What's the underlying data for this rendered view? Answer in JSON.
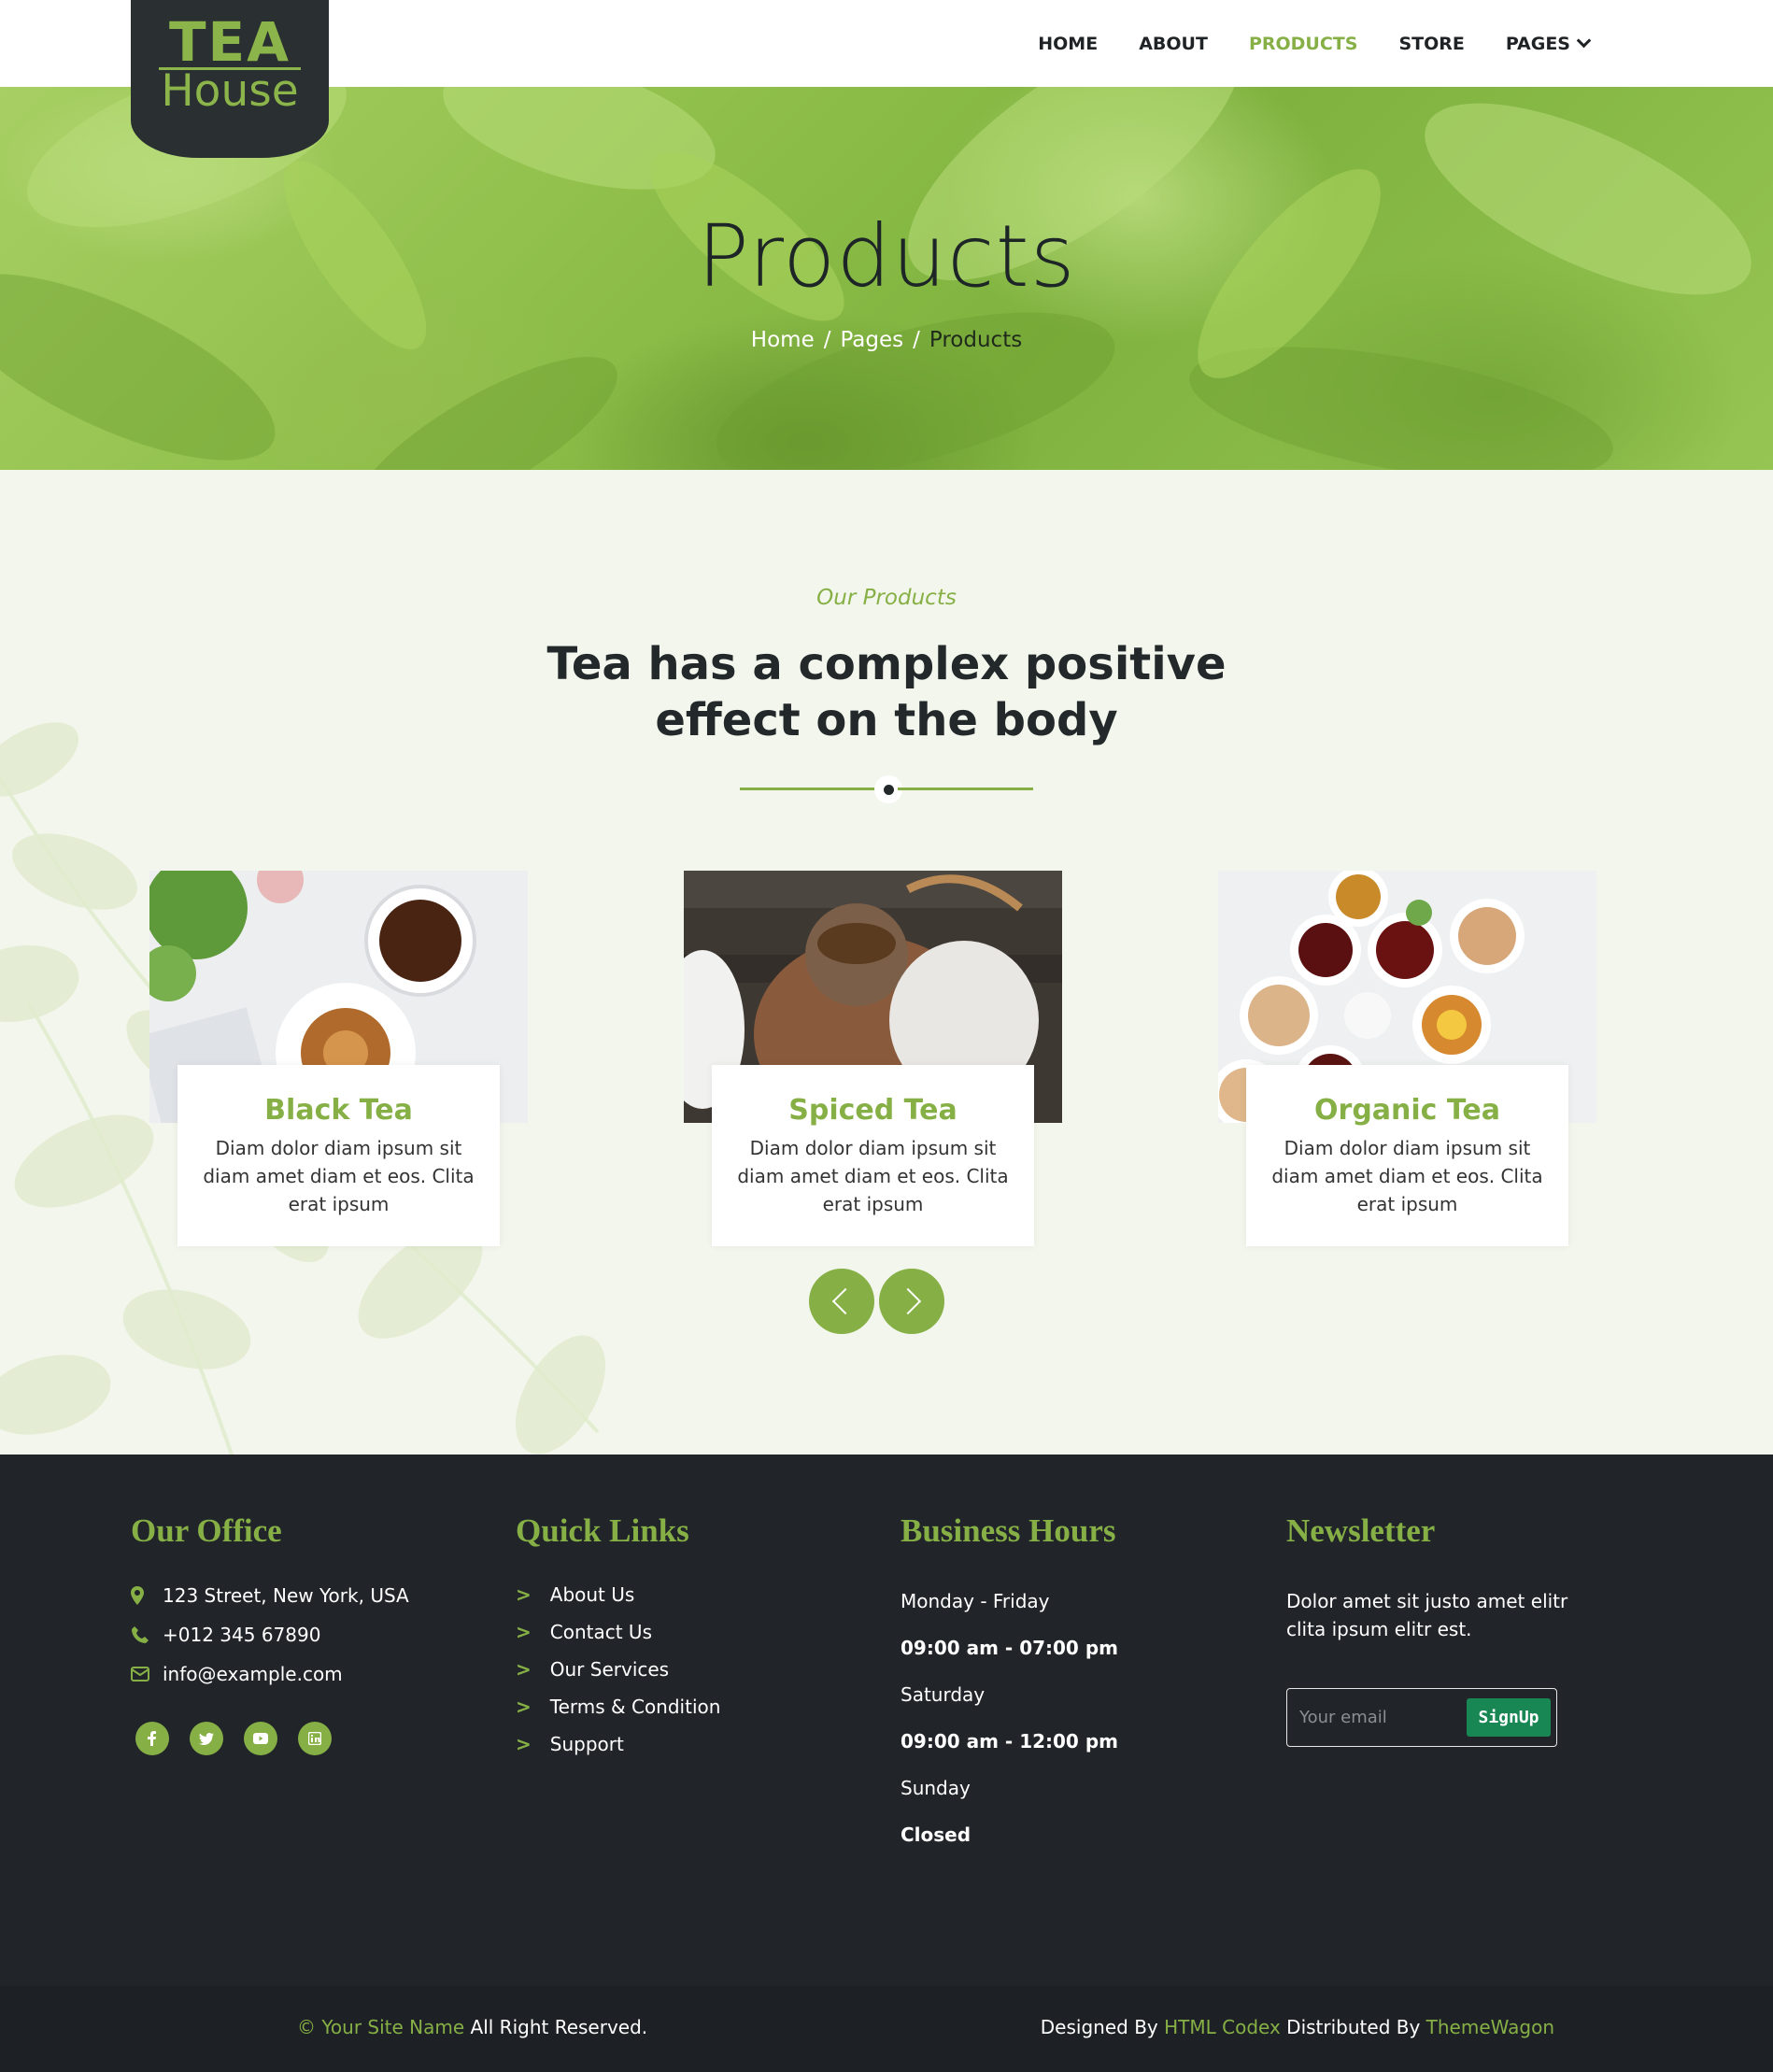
{
  "brand": {
    "line1": "TEA",
    "line2": "House"
  },
  "nav": {
    "items": [
      {
        "label": "HOME"
      },
      {
        "label": "ABOUT"
      },
      {
        "label": "PRODUCTS",
        "active": true
      },
      {
        "label": "STORE"
      },
      {
        "label": "PAGES"
      }
    ]
  },
  "hero": {
    "title": "Products",
    "breadcrumb": [
      "Home",
      "Pages",
      "Products"
    ],
    "separator": "/"
  },
  "products_section": {
    "subtitle": "Our Products",
    "title": "Tea has a complex positive effect on the body",
    "cards": [
      {
        "name": "Black Tea",
        "description": "Diam dolor diam ipsum sit diam amet diam et eos. Clita erat ipsum"
      },
      {
        "name": "Spiced Tea",
        "description": "Diam dolor diam ipsum sit diam amet diam et eos. Clita erat ipsum"
      },
      {
        "name": "Organic Tea",
        "description": "Diam dolor diam ipsum sit diam amet diam et eos. Clita erat ipsum"
      }
    ]
  },
  "footer": {
    "office": {
      "heading": "Our Office",
      "address": "123 Street, New York, USA",
      "phone": "+012 345 67890",
      "email": "info@example.com",
      "socials": [
        "facebook-icon",
        "twitter-icon",
        "youtube-icon",
        "linkedin-icon"
      ]
    },
    "links": {
      "heading": "Quick Links",
      "marker": ">",
      "items": [
        "About Us",
        "Contact Us",
        "Our Services",
        "Terms & Condition",
        "Support"
      ]
    },
    "hours": {
      "heading": "Business Hours",
      "rows": [
        "Monday - Friday",
        "09:00 am - 07:00 pm",
        "Saturday",
        "09:00 am - 12:00 pm",
        "Sunday",
        "Closed"
      ]
    },
    "newsletter": {
      "heading": "Newsletter",
      "text": "Dolor amet sit justo amet elitr clita ipsum elitr est.",
      "placeholder": "Your email",
      "button": "SignUp"
    }
  },
  "copyright": {
    "site_name": "© Your Site Name",
    "reserved": "All Right Reserved.",
    "designed_by": "Designed By",
    "designer": "HTML Codex",
    "distributed_by": "Distributed By",
    "distributor": "ThemeWagon"
  },
  "colors": {
    "accent": "#86b045",
    "dark": "#212529",
    "section_bg": "#f3f6ec",
    "signup": "#198754"
  }
}
